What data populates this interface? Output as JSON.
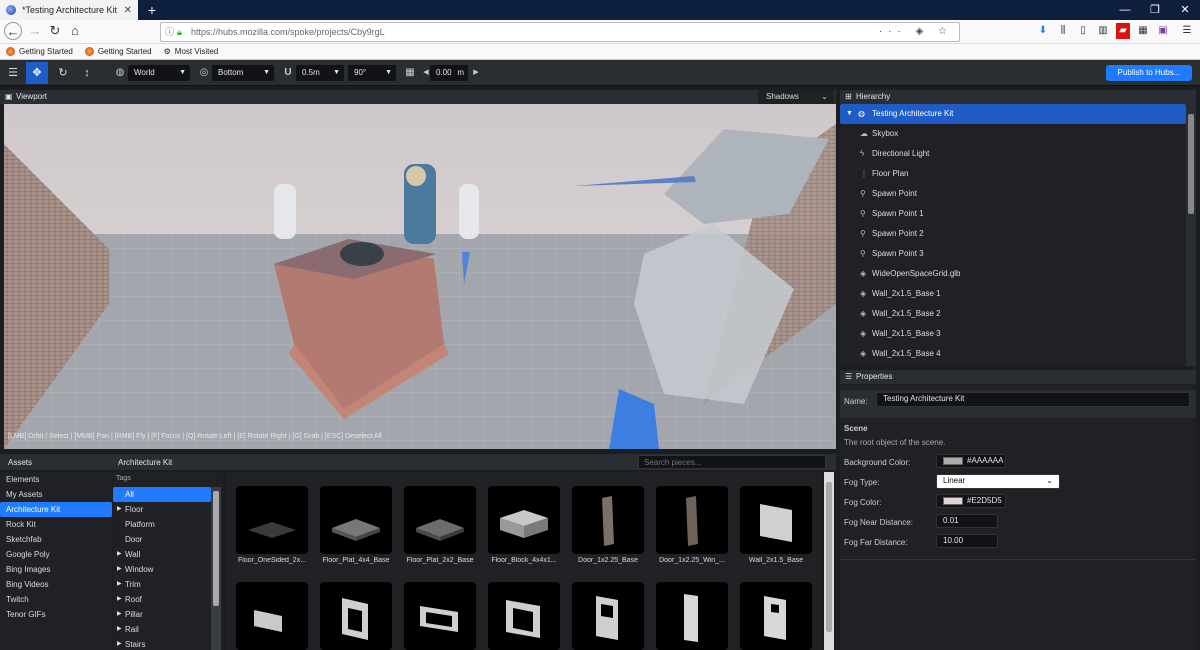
{
  "browser": {
    "tab_title": "*Testing Architecture Kit | Spoke",
    "new_tab": "+",
    "url": "https://hubs.mozilla.com/spoke/projects/Cby9rgL",
    "url_actions": "··· ◈ ☆",
    "bookmarks": [
      "Getting Started",
      "Getting Started",
      "Most Visited"
    ]
  },
  "toolbar": {
    "space_value": "World",
    "pivot_value": "Bottom",
    "snap_translate": "0.5m",
    "snap_rotate": "90°",
    "grid_height": "0.00",
    "grid_unit": "m",
    "publish_label": "Publish to Hubs..."
  },
  "viewport": {
    "title": "Viewport",
    "shadows_label": "Shadows",
    "help_text": "[LMB] Orbit / Select | [MMB] Pan | [RMB] Fly | [F] Focus | [Q] Rotate Left | [E] Rotate Right | [G] Grab | [ESC] Deselect All"
  },
  "hierarchy": {
    "title": "Hierarchy",
    "items": [
      {
        "label": "Testing Architecture Kit",
        "icon": "globe-icon",
        "selected": true
      },
      {
        "label": "Skybox",
        "icon": "cloud-icon"
      },
      {
        "label": "Directional Light",
        "icon": "bolt-icon"
      },
      {
        "label": "Floor Plan",
        "icon": "shoe-prints-icon"
      },
      {
        "label": "Spawn Point",
        "icon": "street-view-icon"
      },
      {
        "label": "Spawn Point 1",
        "icon": "street-view-icon"
      },
      {
        "label": "Spawn Point 2",
        "icon": "street-view-icon"
      },
      {
        "label": "Spawn Point 3",
        "icon": "street-view-icon"
      },
      {
        "label": "WideOpenSpaceGrid.glb",
        "icon": "cube-icon"
      },
      {
        "label": "Wall_2x1.5_Base 1",
        "icon": "cube-icon"
      },
      {
        "label": "Wall_2x1.5_Base 2",
        "icon": "cube-icon"
      },
      {
        "label": "Wall_2x1.5_Base 3",
        "icon": "cube-icon"
      },
      {
        "label": "Wall_2x1.5_Base 4",
        "icon": "cube-icon"
      }
    ]
  },
  "properties": {
    "title": "Properties",
    "name_label": "Name:",
    "name_value": "Testing Architecture Kit",
    "section": "Scene",
    "description": "The root object of the scene.",
    "background_color_label": "Background Color:",
    "background_color": "#AAAAAA",
    "fog_type_label": "Fog Type:",
    "fog_type": "Linear",
    "fog_color_label": "Fog Color:",
    "fog_color": "#E2D5D5",
    "fog_near_label": "Fog Near Distance:",
    "fog_near": "0.01",
    "fog_far_label": "Fog Far Distance:",
    "fog_far": "10.00"
  },
  "assets": {
    "title": "Assets",
    "sources": [
      "Elements",
      "My Assets",
      "Architecture Kit",
      "Rock Kit",
      "Sketchfab",
      "Google Poly",
      "Bing Images",
      "Bing Videos",
      "Twitch",
      "Tenor GIFs"
    ],
    "selected_source": 2,
    "source_title": "Architecture Kit",
    "search_placeholder": "Search pieces...",
    "tags_title": "Tags",
    "tags": [
      {
        "label": "All",
        "expandable": false,
        "selected": true
      },
      {
        "label": "Floor",
        "expandable": true
      },
      {
        "label": "Platform",
        "expandable": false
      },
      {
        "label": "Door",
        "expandable": false
      },
      {
        "label": "Wall",
        "expandable": true
      },
      {
        "label": "Window",
        "expandable": true
      },
      {
        "label": "Trim",
        "expandable": true
      },
      {
        "label": "Roof",
        "expandable": true
      },
      {
        "label": "Pillar",
        "expandable": true
      },
      {
        "label": "Rail",
        "expandable": true
      },
      {
        "label": "Stairs",
        "expandable": true
      }
    ],
    "pieces": [
      "Floor_OneSided_2x...",
      "Floor_Plat_4x4_Base",
      "Floor_Plat_2x2_Base",
      "Floor_Block_4x4x1...",
      "Door_1x2.25_Base",
      "Door_1x2.25_Win_...",
      "Wall_2x1.5_Base",
      "",
      "",
      "",
      "",
      "",
      "",
      ""
    ]
  },
  "colors": {
    "accent": "#1f7bff",
    "selected_row": "#1f5cc7",
    "panel": "#1f2125",
    "header": "#2a2d32"
  }
}
